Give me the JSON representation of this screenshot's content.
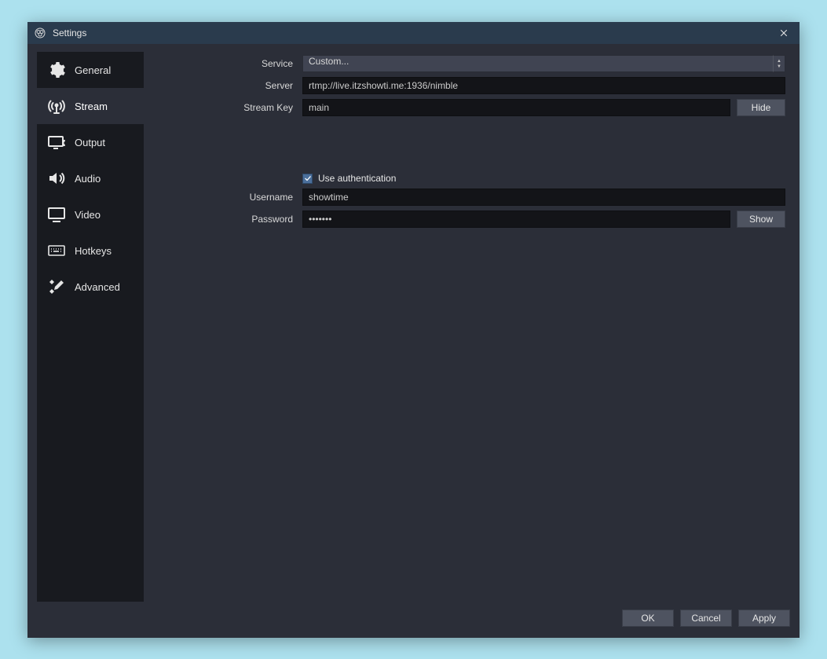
{
  "titlebar": {
    "title": "Settings"
  },
  "sidebar": {
    "items": [
      {
        "label": "General"
      },
      {
        "label": "Stream"
      },
      {
        "label": "Output"
      },
      {
        "label": "Audio"
      },
      {
        "label": "Video"
      },
      {
        "label": "Hotkeys"
      },
      {
        "label": "Advanced"
      }
    ],
    "active_index": 1
  },
  "stream": {
    "service_label": "Service",
    "service_value": "Custom...",
    "server_label": "Server",
    "server_value": "rtmp://live.itzshowti.me:1936/nimble",
    "stream_key_label": "Stream Key",
    "stream_key_value": "main",
    "hide_button": "Hide",
    "use_auth_label": "Use authentication",
    "use_auth_checked": true,
    "username_label": "Username",
    "username_value": "showtime",
    "password_label": "Password",
    "password_masked": "•••••••",
    "show_button": "Show"
  },
  "footer": {
    "ok": "OK",
    "cancel": "Cancel",
    "apply": "Apply"
  }
}
